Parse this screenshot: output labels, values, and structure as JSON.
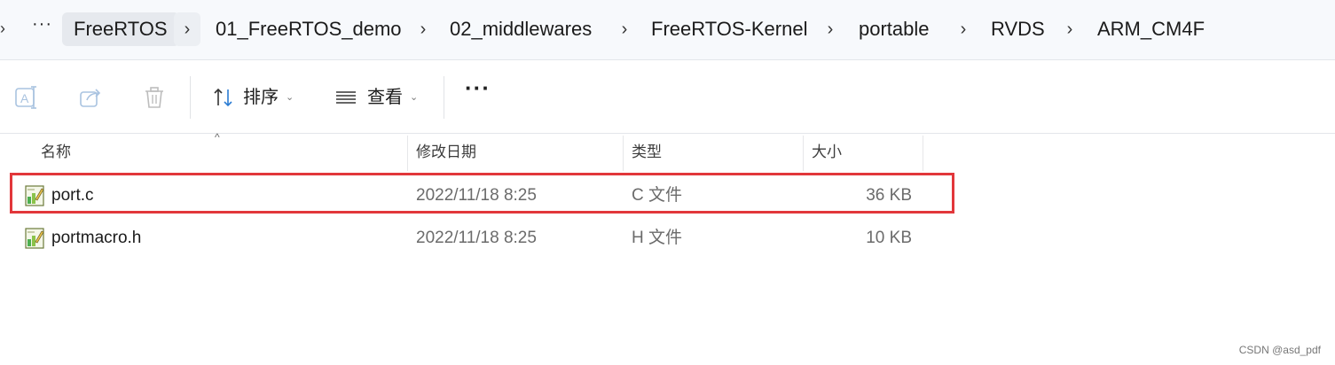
{
  "breadcrumb": {
    "overflow_label": "···",
    "items": [
      "FreeRTOS",
      "01_FreeRTOS_demo",
      "02_middlewares",
      "FreeRTOS-Kernel",
      "portable",
      "RVDS",
      "ARM_CM4F"
    ],
    "separator": "›"
  },
  "toolbar": {
    "icons": [
      "rename-icon",
      "share-icon",
      "delete-icon"
    ],
    "sort_label": "排序",
    "view_label": "查看",
    "more_label": "···"
  },
  "columns": {
    "name": "名称",
    "date": "修改日期",
    "type": "类型",
    "size": "大小"
  },
  "files": [
    {
      "name": "port.c",
      "date": "2022/11/18 8:25",
      "type": "C 文件",
      "size": "36 KB",
      "highlighted": true
    },
    {
      "name": "portmacro.h",
      "date": "2022/11/18 8:25",
      "type": "H 文件",
      "size": "10 KB",
      "highlighted": false
    }
  ],
  "watermark": "CSDN @asd_pdf",
  "colors": {
    "highlight_border": "#e2373b",
    "address_bar_bg": "#f7f9fc",
    "accent": "#2b7cd3"
  }
}
